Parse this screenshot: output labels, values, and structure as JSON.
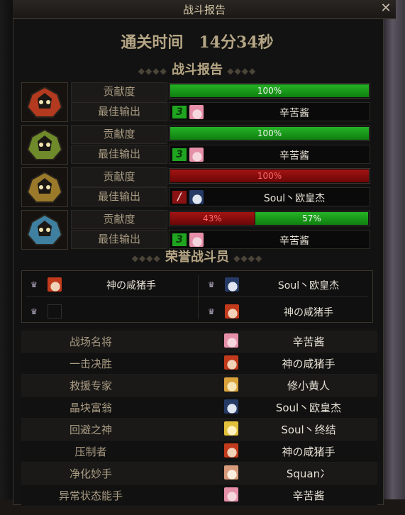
{
  "window": {
    "title": "战斗报告",
    "close_glyph": "✕"
  },
  "clear_time": "通关时间　14分34秒",
  "section_report": "战斗报告",
  "section_honor": "荣誉战斗员",
  "labels": {
    "contribution": "贡献度",
    "best_output": "最佳输出"
  },
  "bosses": [
    {
      "icon": "fire-boss-icon",
      "color": "#b33a1f",
      "segments": [
        {
          "label": "100%",
          "fraction": 1.0,
          "color": "green"
        }
      ],
      "best_badge": "3",
      "badge_color": "green",
      "best_avatar": "pink-hair-avatar",
      "best_name": "辛苦酱"
    },
    {
      "icon": "nature-boss-icon",
      "color": "#6f8a2a",
      "segments": [
        {
          "label": "100%",
          "fraction": 1.0,
          "color": "green"
        }
      ],
      "best_badge": "3",
      "badge_color": "green",
      "best_avatar": "pink-hair-avatar",
      "best_name": "辛苦酱"
    },
    {
      "icon": "gold-boss-icon",
      "color": "#9a7a2a",
      "segments": [
        {
          "label": "100%",
          "fraction": 1.0,
          "color": "red"
        }
      ],
      "best_badge": "/",
      "badge_color": "red",
      "best_avatar": "dark-hair-avatar",
      "best_name": "Soul丶欧皇杰"
    },
    {
      "icon": "ice-boss-icon",
      "color": "#3f7fa0",
      "segments": [
        {
          "label": "43%",
          "fraction": 0.43,
          "color": "red"
        },
        {
          "label": "57%",
          "fraction": 0.57,
          "color": "green"
        }
      ],
      "best_badge": "3",
      "badge_color": "green",
      "best_avatar": "pink-hair-avatar",
      "best_name": "辛苦酱"
    }
  ],
  "honor": [
    {
      "crown": "crown-icon",
      "avatar": "red-hair-avatar",
      "name": "神の咸猪手"
    },
    {
      "crown": "crown-icon",
      "avatar": "dark-hair-avatar",
      "name": "Soul丶欧皇杰"
    },
    {
      "crown": "crown-icon",
      "avatar": "empty",
      "name": ""
    },
    {
      "crown": "crown-icon",
      "avatar": "red-hair-avatar",
      "name": "神の咸猪手"
    }
  ],
  "awards": [
    {
      "title": "战场名将",
      "avatar": "pink-hair-avatar",
      "name": "辛苦酱"
    },
    {
      "title": "一击决胜",
      "avatar": "red-hair-avatar",
      "name": "神の咸猪手"
    },
    {
      "title": "救援专家",
      "avatar": "blonde-avatar",
      "name": "修小黄人"
    },
    {
      "title": "晶块富翁",
      "avatar": "dark-hair-avatar",
      "name": "Soul丶欧皇杰"
    },
    {
      "title": "回避之神",
      "avatar": "yellow-avatar",
      "name": "Soul丶终结"
    },
    {
      "title": "压制者",
      "avatar": "red-hair-avatar",
      "name": "神の咸猪手"
    },
    {
      "title": "净化妙手",
      "avatar": "light-avatar",
      "name": "Squan冫"
    },
    {
      "title": "异常状态能手",
      "avatar": "pink-hair-avatar",
      "name": "辛苦酱"
    }
  ],
  "colors": {
    "panel": "#121212",
    "gold_text": "#b5a583",
    "bar_green": "#1f9f1f",
    "bar_red": "#8f0f0f"
  }
}
